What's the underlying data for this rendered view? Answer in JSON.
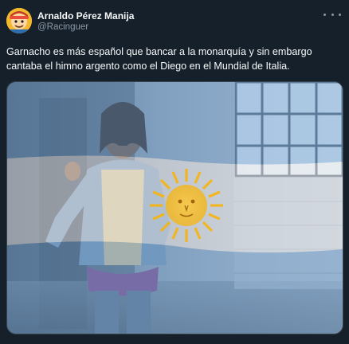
{
  "tweet": {
    "author": {
      "display_name": "Arnaldo Pérez Manija",
      "handle": "@Racinguer",
      "avatar_icon": "cartoon-avatar-icon"
    },
    "text": "Garnacho es más español que bancar a la monarquía y sin embargo cantaba el himno argento como el Diego en el Mundial de Italia.",
    "more_icon": "more-options-icon",
    "media": {
      "kind": "photo",
      "description_icon": "argentina-flag-overlay-image"
    }
  },
  "colors": {
    "background": "#15202b",
    "text": "#f7f9f9",
    "secondary_text": "#8b98a5",
    "flag_blue": "#74acdf",
    "flag_sun": "#f6b40e"
  }
}
